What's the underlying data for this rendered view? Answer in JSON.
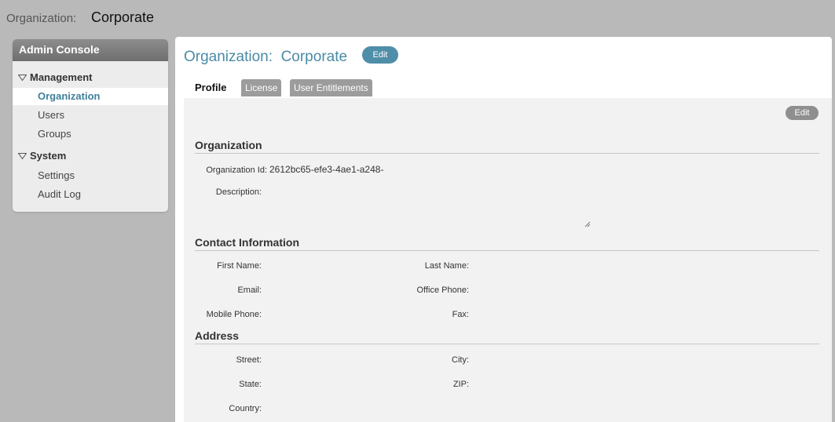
{
  "topbar": {
    "label": "Organization:",
    "value": "Corporate"
  },
  "sidebar": {
    "header": "Admin Console",
    "sections": [
      {
        "label": "Management",
        "items": [
          "Organization",
          "Users",
          "Groups"
        ]
      },
      {
        "label": "System",
        "items": [
          "Settings",
          "Audit Log"
        ]
      }
    ],
    "active_item": "Organization"
  },
  "main": {
    "title": "Organization:  Corporate",
    "edit_label": "Edit",
    "tabs": [
      "Profile",
      "License",
      "User Entitlements"
    ],
    "active_tab": "Profile",
    "content_edit_label": "Edit",
    "sections": {
      "organization": "Organization",
      "contact": "Contact Information",
      "address": "Address"
    },
    "organization": {
      "id_label": "Organization Id:",
      "id_value": "2612bc65-efe3-4ae1-a248-",
      "description_label": "Description:"
    },
    "contact": {
      "first_name_label": "First Name:",
      "last_name_label": "Last Name:",
      "email_label": "Email:",
      "office_phone_label": "Office Phone:",
      "mobile_phone_label": "Mobile Phone:",
      "fax_label": "Fax:"
    },
    "address": {
      "street_label": "Street:",
      "city_label": "City:",
      "state_label": "State:",
      "zip_label": "ZIP:",
      "country_label": "Country:"
    }
  },
  "colors": {
    "accent": "#4a8ba6",
    "background": "#b9b9b9",
    "panel": "#f2f2f2"
  }
}
